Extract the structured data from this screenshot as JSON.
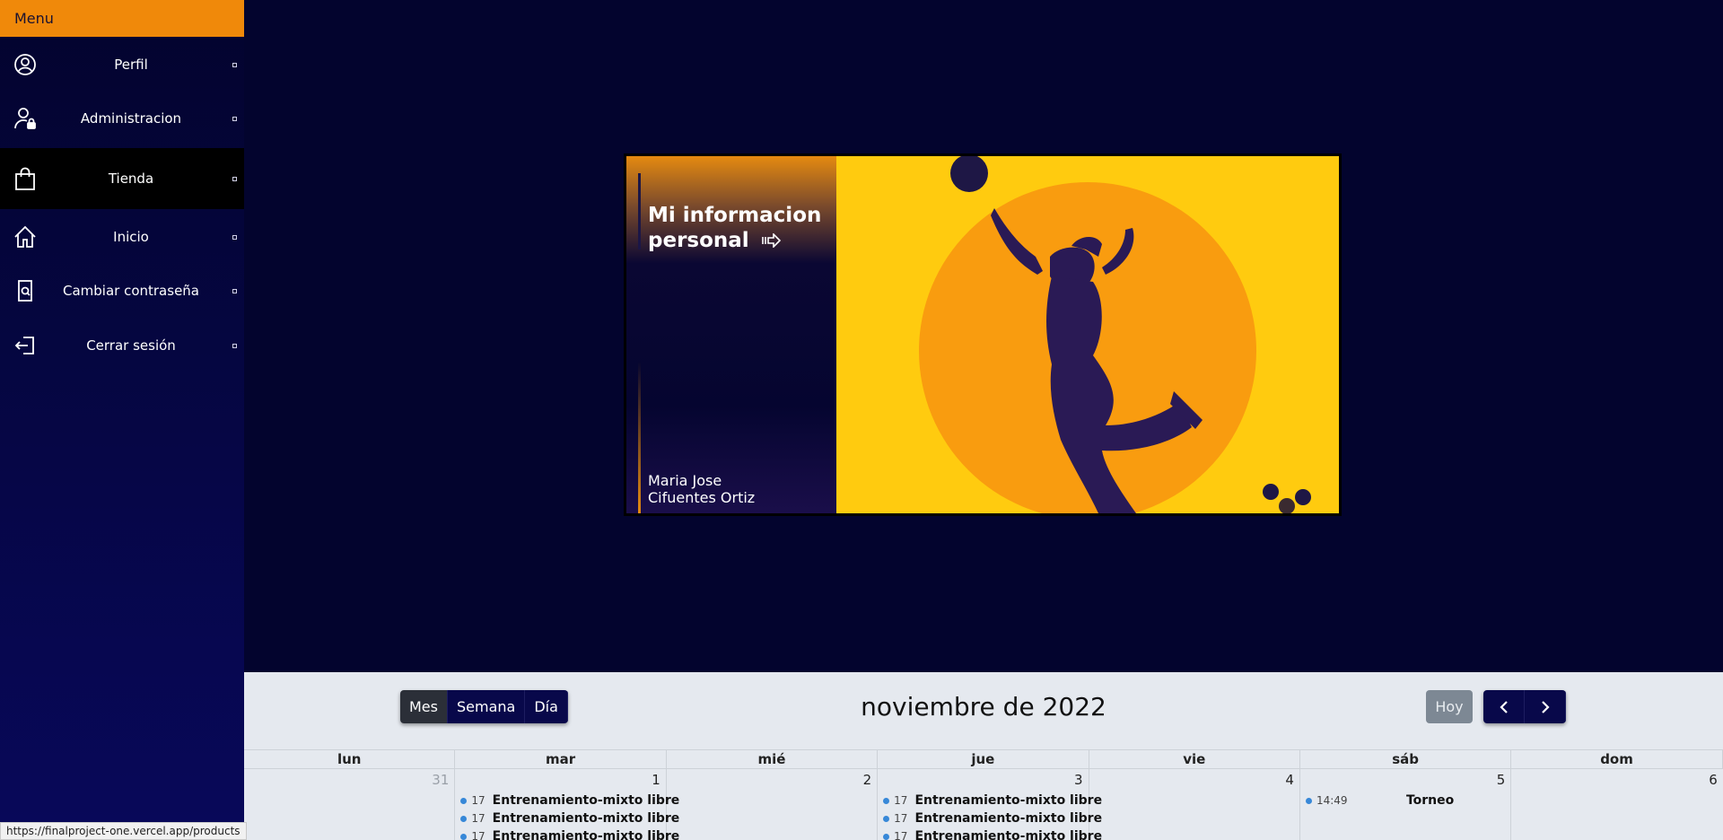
{
  "sidebar": {
    "title": "Menu",
    "items": [
      {
        "label": "Perfil",
        "icon": "user-circle-icon"
      },
      {
        "label": "Administracion",
        "icon": "user-lock-icon"
      },
      {
        "label": "Tienda",
        "icon": "shopping-bag-icon"
      },
      {
        "label": "Inicio",
        "icon": "home-icon"
      },
      {
        "label": "Cambiar contraseña",
        "icon": "password-icon"
      },
      {
        "label": "Cerrar sesión",
        "icon": "logout-icon"
      }
    ]
  },
  "hero": {
    "title": "Mi informacion personal",
    "name_line1": "Maria Jose",
    "name_line2": "Cifuentes Ortiz"
  },
  "calendar": {
    "views": [
      "Mes",
      "Semana",
      "Día"
    ],
    "active_view": "Mes",
    "title": "noviembre de 2022",
    "today_label": "Hoy",
    "days_of_week": [
      "lun",
      "mar",
      "mié",
      "jue",
      "vie",
      "sáb",
      "dom"
    ],
    "week": [
      {
        "day": "31",
        "events": []
      },
      {
        "day": "1",
        "events": [
          {
            "time": "17",
            "title": "Entrenamiento-mixto libre"
          },
          {
            "time": "17",
            "title": "Entrenamiento-mixto libre"
          },
          {
            "time": "17",
            "title": "Entrenamiento-mixto libre"
          }
        ]
      },
      {
        "day": "2",
        "events": []
      },
      {
        "day": "3",
        "events": [
          {
            "time": "17",
            "title": "Entrenamiento-mixto libre"
          },
          {
            "time": "17",
            "title": "Entrenamiento-mixto libre"
          },
          {
            "time": "17",
            "title": "Entrenamiento-mixto libre"
          }
        ]
      },
      {
        "day": "4",
        "events": []
      },
      {
        "day": "5",
        "events": [
          {
            "time": "14:49",
            "title": "Torneo"
          }
        ]
      },
      {
        "day": "6",
        "events": []
      }
    ]
  },
  "status_bar": {
    "url": "https://finalproject-one.vercel.app/products"
  },
  "colors": {
    "background": "#03042e",
    "accent": "#f0890a",
    "hero_yellow": "#ffcb0f",
    "hero_orange": "#f99c0f",
    "calendar_bg": "#e5e9ef",
    "event_dot": "#3788d8"
  }
}
